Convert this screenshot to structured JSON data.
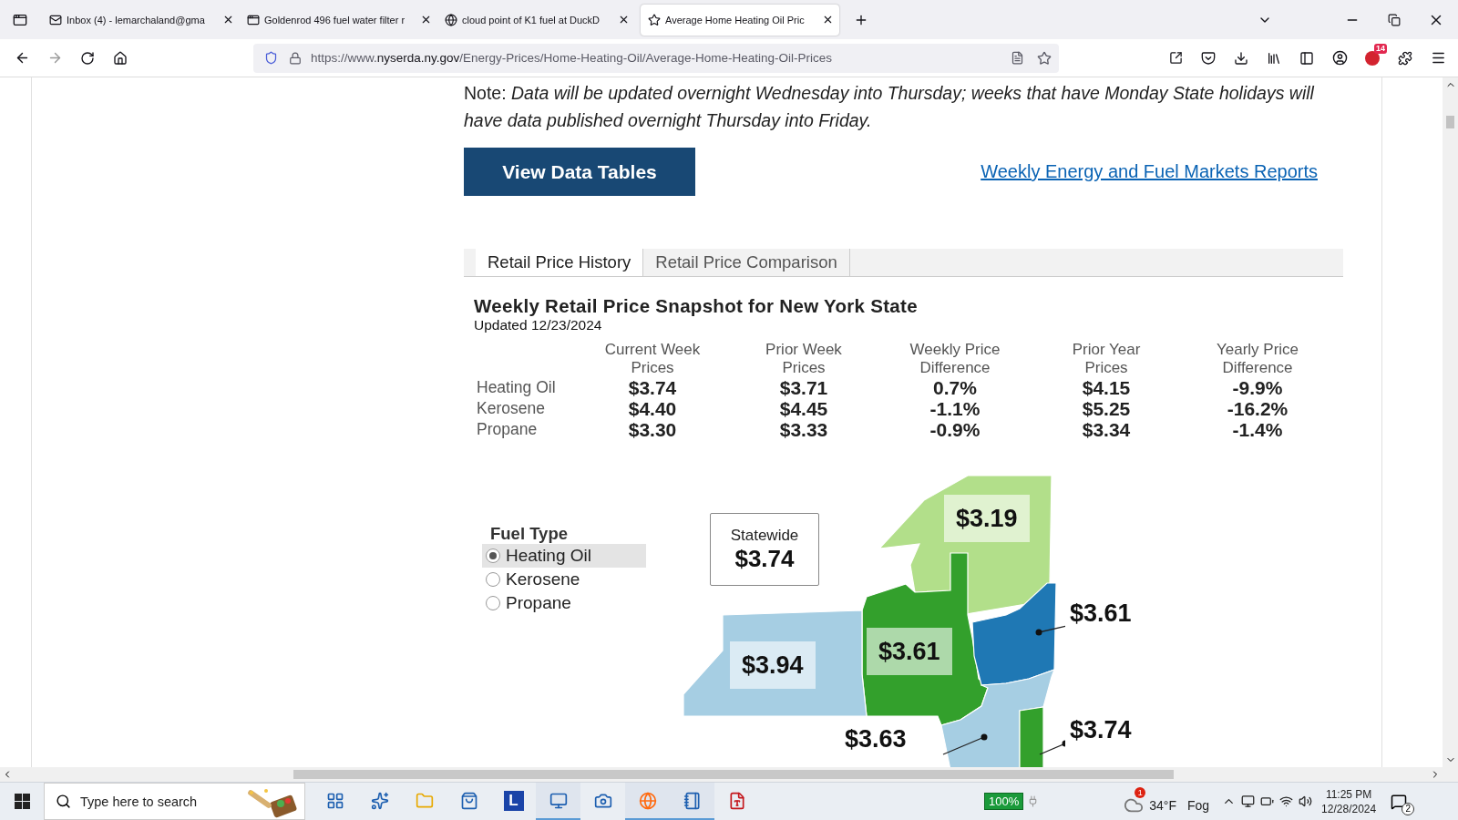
{
  "browser": {
    "tabs": [
      {
        "title": "Inbox (4) - lemarchaland@gma",
        "selected": false
      },
      {
        "title": "Goldenrod 496 fuel water filter r",
        "selected": false
      },
      {
        "title": "cloud point of K1 fuel at DuckD",
        "selected": false
      },
      {
        "title": "Average Home Heating Oil Pric",
        "selected": true
      }
    ],
    "url": {
      "scheme": "https://www.",
      "domain": "nyserda.ny.gov",
      "path": "/Energy-Prices/Home-Heating-Oil/Average-Home-Heating-Oil-Prices"
    },
    "extension_badge": "14"
  },
  "page": {
    "note": {
      "label": "Note:",
      "text": "Data will be updated overnight Wednesday into Thursday; weeks that have Monday State holidays will have data published overnight Thursday into Friday."
    },
    "button": "View Data Tables",
    "link": "Weekly Energy and Fuel Markets Reports",
    "view_tabs": [
      {
        "label": "Retail Price History",
        "selected": true
      },
      {
        "label": "Retail Price Comparison",
        "selected": false
      }
    ],
    "snapshot": {
      "title": "Weekly Retail Price Snapshot for New York State",
      "updated": "Updated 12/23/2024",
      "columns": [
        "Current Week Prices",
        "Prior Week Prices",
        "Weekly Price Difference",
        "Prior Year Prices",
        "Yearly Price Difference"
      ],
      "rows": [
        {
          "fuel": "Heating Oil",
          "values": [
            "$3.74",
            "$3.71",
            "0.7%",
            "$4.15",
            "-9.9%"
          ]
        },
        {
          "fuel": "Kerosene",
          "values": [
            "$4.40",
            "$4.45",
            "-1.1%",
            "$5.25",
            "-16.2%"
          ]
        },
        {
          "fuel": "Propane",
          "values": [
            "$3.30",
            "$3.33",
            "-0.9%",
            "$3.34",
            "-1.4%"
          ]
        }
      ]
    },
    "fuel_type": {
      "title": "Fuel Type",
      "options": [
        {
          "label": "Heating Oil",
          "selected": true
        },
        {
          "label": "Kerosene",
          "selected": false
        },
        {
          "label": "Propane",
          "selected": false
        }
      ]
    },
    "map": {
      "statewide_label": "Statewide",
      "statewide_value": "$3.74",
      "regions": [
        {
          "price": "$3.19",
          "color": "#b2df8a"
        },
        {
          "price": "$3.61",
          "color": "#33a02c"
        },
        {
          "price": "$3.94",
          "color": "#a6cee3"
        },
        {
          "price": "$3.61",
          "color": "#1f78b4"
        },
        {
          "price": "$3.63",
          "color": "#a6cee3"
        },
        {
          "price": "$3.74",
          "color": "#33a02c"
        }
      ]
    }
  },
  "taskbar": {
    "search_placeholder": "Type here to search",
    "apps": [
      {
        "kind": "taskview",
        "running": false
      },
      {
        "kind": "copilot",
        "running": false
      },
      {
        "kind": "folder",
        "running": false
      },
      {
        "kind": "store",
        "running": false
      },
      {
        "kind": "letter",
        "label": "L",
        "running": false
      },
      {
        "kind": "monitor",
        "running": true
      },
      {
        "kind": "camera",
        "running": false
      },
      {
        "kind": "browser",
        "running": true
      },
      {
        "kind": "notes",
        "running": true
      },
      {
        "kind": "pdf",
        "running": false
      }
    ],
    "battery": "100%",
    "weather_badge": "1",
    "temperature": "34°F",
    "condition": "Fog",
    "time": "11:25 PM",
    "date": "12/28/2024",
    "notifications": "2"
  }
}
